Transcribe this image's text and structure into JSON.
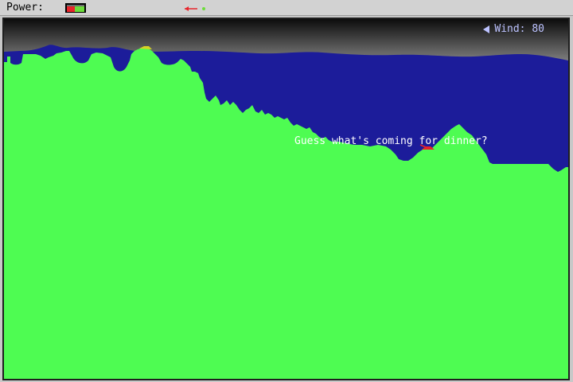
{
  "hud": {
    "power_label": "Power:",
    "power_fraction": 0.45,
    "angle_indicator_icon": "angle-arrow-icon"
  },
  "wind": {
    "label": "Wind: 80",
    "direction_icon": "wind-left-arrow-icon"
  },
  "taunt": {
    "text": "Guess what's coming for dinner?"
  },
  "colors": {
    "sky": "#1c1c9a",
    "terrain": "#4efc52",
    "ceiling_top": "#101010",
    "ceiling_bottom": "#7d7d7d",
    "player_tank": "#d9d224",
    "enemy_tank": "#e8242a",
    "hud_background": "#d2d2d2"
  },
  "tanks": [
    {
      "name": "player",
      "color": "#d9d224"
    },
    {
      "name": "enemy",
      "color": "#e8242a"
    }
  ]
}
